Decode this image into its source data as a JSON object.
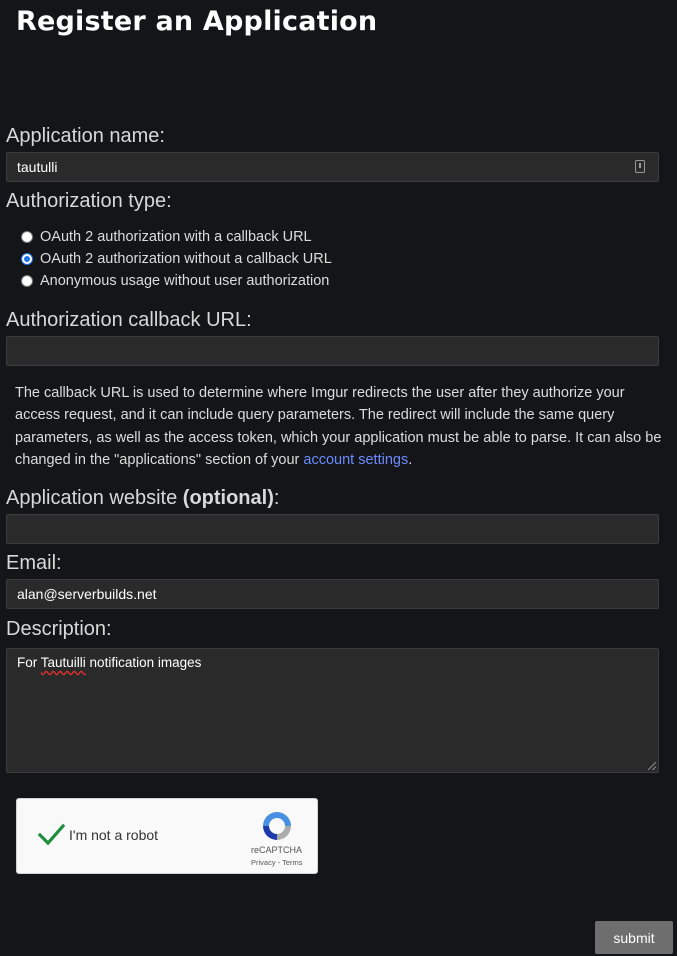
{
  "page": {
    "title": "Register an Application"
  },
  "form": {
    "app_name": {
      "label": "Application name:",
      "value": "tautulli"
    },
    "auth_type": {
      "label": "Authorization type:",
      "options": [
        {
          "label": "OAuth 2 authorization with a callback URL",
          "checked": false
        },
        {
          "label": "OAuth 2 authorization without a callback URL",
          "checked": true
        },
        {
          "label": "Anonymous usage without user authorization",
          "checked": false
        }
      ]
    },
    "callback_url": {
      "label": "Authorization callback URL:",
      "value": ""
    },
    "help": {
      "line1": "The callback URL is used to determine where Imgur redirects the user after they authorize your",
      "line2": "access request, and it can include query parameters. The redirect will include the same query",
      "line3": "parameters, as well as the access token, which your application must be able to parse. It can also be",
      "line4_prefix": "changed in the \"applications\" section of your ",
      "link_text": "account settings",
      "line4_suffix": "."
    },
    "website": {
      "label": "Application website ",
      "label_emphasis": "(optional)",
      "label_suffix": ":",
      "value": ""
    },
    "email": {
      "label": "Email:",
      "value": "alan@serverbuilds.net"
    },
    "description": {
      "label": "Description:",
      "value_prefix": "For ",
      "value_misspelled": "Tautuilli",
      "value_suffix": " notification images"
    },
    "captcha": {
      "label": "I'm not a robot",
      "brand": "reCAPTCHA",
      "links": "Privacy - Terms"
    },
    "submit_label": "submit"
  },
  "colors": {
    "background": "#141518",
    "link": "#6b8cff",
    "radio_checked": "#1a73e8",
    "captcha_check": "#1e8e3e"
  }
}
